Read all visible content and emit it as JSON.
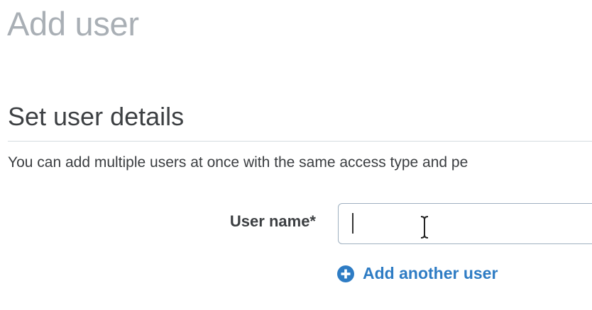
{
  "page": {
    "title": "Add user"
  },
  "section": {
    "title": "Set user details",
    "description": "You can add multiple users at once with the same access type and pe"
  },
  "form": {
    "username_label": "User name*",
    "username_value": "",
    "username_placeholder": ""
  },
  "actions": {
    "add_another_label": "Add another user",
    "add_another_icon": "plus-circle-icon"
  },
  "colors": {
    "link": "#2e7cc4",
    "title_muted": "#a9afb5",
    "input_border": "#9fb0c0"
  }
}
